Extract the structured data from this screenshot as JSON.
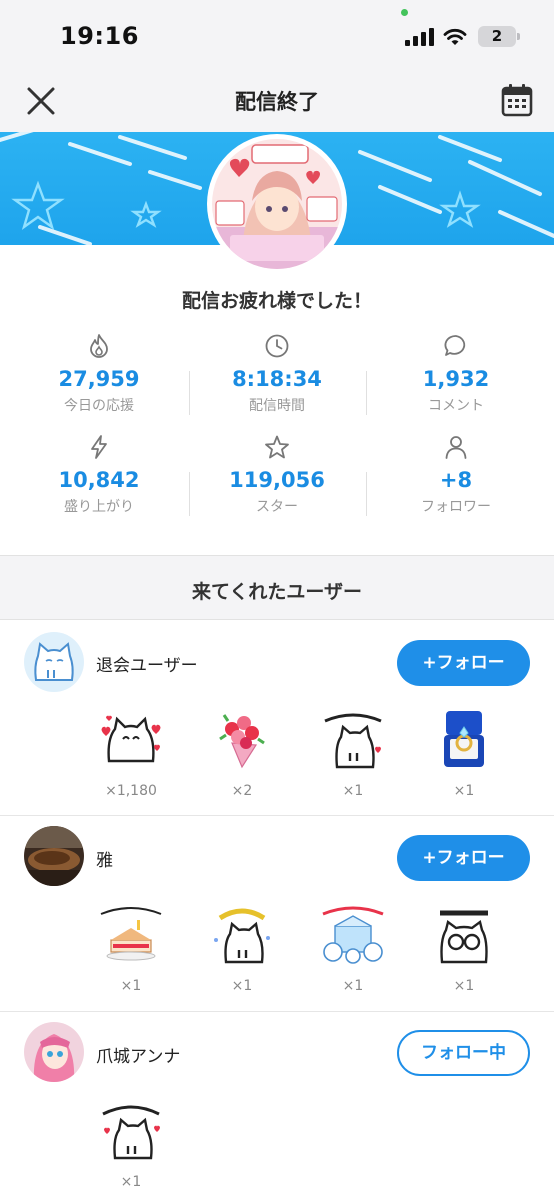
{
  "status_bar": {
    "time": "19:16",
    "battery": "2"
  },
  "header": {
    "title": "配信終了"
  },
  "summary": {
    "title": "配信お疲れ様でした！",
    "stats": [
      {
        "icon": "flame-icon",
        "value": "27,959",
        "label": "今日の応援"
      },
      {
        "icon": "clock-icon",
        "value": "8:18:34",
        "label": "配信時間"
      },
      {
        "icon": "chat-bubble-icon",
        "value": "1,932",
        "label": "コメント"
      },
      {
        "icon": "lightning-icon",
        "value": "10,842",
        "label": "盛り上がり"
      },
      {
        "icon": "star-icon",
        "value": "119,056",
        "label": "スター"
      },
      {
        "icon": "person-icon",
        "value": "+8",
        "label": "フォロワー"
      }
    ]
  },
  "visitors": {
    "title": "来てくれたユーザー",
    "users": [
      {
        "name": "退会ユーザー",
        "button": "+フォロー",
        "gifts": [
          {
            "icon": "cat-hearts-icon",
            "count": "×1,180"
          },
          {
            "icon": "bouquet-icon",
            "count": "×2"
          },
          {
            "icon": "cat-sugoi-icon",
            "count": "×1"
          },
          {
            "icon": "ring-box-icon",
            "count": "×1"
          }
        ]
      },
      {
        "name": "雅",
        "button": "+フォロー",
        "gifts": [
          {
            "icon": "birthday-cake-icon",
            "count": "×1"
          },
          {
            "icon": "cat-erai-icon",
            "count": "×1"
          },
          {
            "icon": "congratulations-icon",
            "count": "×1"
          },
          {
            "icon": "cat-naruhodo-icon",
            "count": "×1"
          }
        ]
      },
      {
        "name": "爪城アンナ",
        "button": "フォロー中",
        "gifts": [
          {
            "icon": "cat-arigatou-icon",
            "count": "×1"
          }
        ]
      }
    ]
  },
  "colors": {
    "accent": "#1f8fe8",
    "banner": "#2cb2f2",
    "value_text": "#1a8ce2"
  }
}
